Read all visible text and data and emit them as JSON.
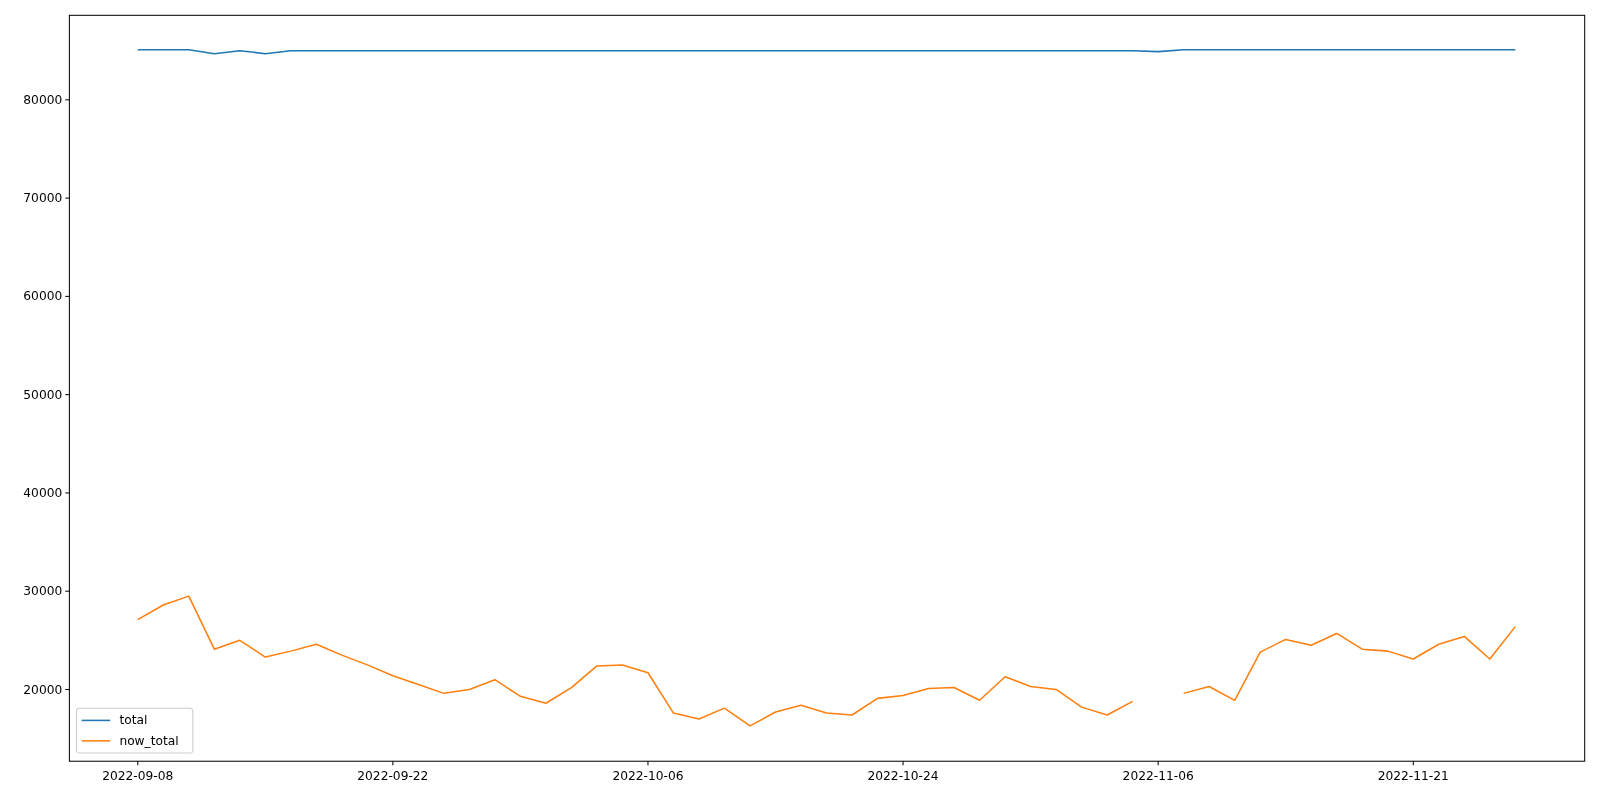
{
  "chart_data": {
    "type": "line",
    "legend": "lower left",
    "categories": [
      "2022-09-08",
      null,
      null,
      null,
      null,
      null,
      null,
      null,
      null,
      null,
      "2022-09-22",
      null,
      null,
      null,
      null,
      null,
      null,
      null,
      null,
      null,
      "2022-10-06",
      null,
      null,
      null,
      null,
      null,
      null,
      null,
      null,
      null,
      "2022-10-24",
      null,
      null,
      null,
      null,
      null,
      null,
      null,
      null,
      null,
      "2022-11-06",
      null,
      null,
      null,
      null,
      null,
      null,
      null,
      null,
      null,
      "2022-11-21",
      null,
      null,
      null,
      null
    ],
    "ylim": [
      12700,
      88600
    ],
    "yticks": [
      20000,
      30000,
      40000,
      50000,
      60000,
      70000,
      80000
    ],
    "series": [
      {
        "name": "total",
        "color": "#1f77b4",
        "values": [
          85100,
          85100,
          85100,
          84700,
          85000,
          84700,
          85000,
          85000,
          85000,
          85000,
          85000,
          85000,
          85000,
          85000,
          85000,
          85000,
          85000,
          85000,
          85000,
          85000,
          85000,
          85000,
          85000,
          85000,
          85000,
          85000,
          85000,
          85000,
          85000,
          85000,
          85000,
          85000,
          85000,
          85000,
          85000,
          85000,
          85000,
          85000,
          85000,
          85000,
          84900,
          85100,
          85100,
          85100,
          85100,
          85100,
          85100,
          85100,
          85100,
          85100,
          85100,
          85100,
          85100,
          85100,
          85100
        ]
      },
      {
        "name": "now_total",
        "color": "#ff7f0e",
        "values": [
          27100,
          28600,
          29500,
          24100,
          25000,
          23300,
          23900,
          24600,
          23500,
          22500,
          21400,
          20500,
          19600,
          20000,
          21000,
          19300,
          18600,
          20200,
          22400,
          22500,
          21700,
          17600,
          17000,
          18100,
          16300,
          17700,
          18400,
          17600,
          17400,
          19100,
          19400,
          20100,
          20200,
          18900,
          21300,
          20300,
          20000,
          18200,
          17400,
          18800,
          null,
          19600,
          20300,
          18900,
          23800,
          25100,
          24500,
          25700,
          24100,
          23900,
          23100,
          24600,
          25400,
          23100,
          26400
        ]
      }
    ]
  }
}
